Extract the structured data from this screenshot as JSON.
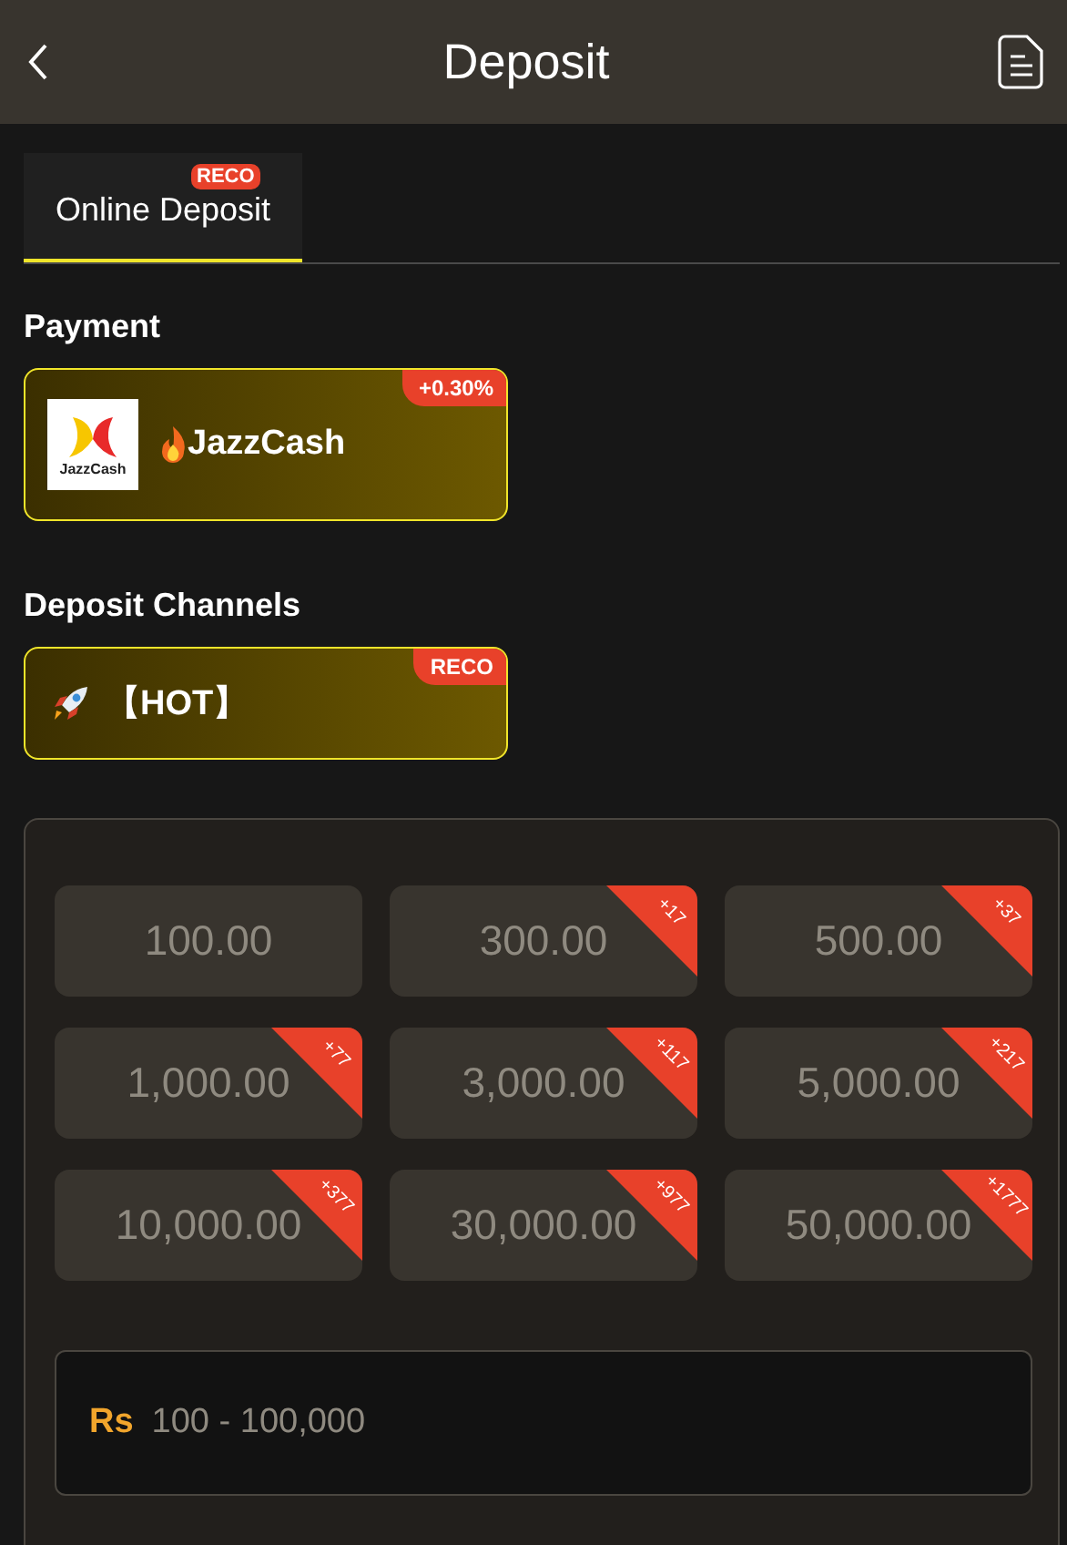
{
  "header": {
    "title": "Deposit"
  },
  "tabs": [
    {
      "label": "Online Deposit",
      "badge": "RECO",
      "selected": true
    }
  ],
  "payment": {
    "heading": "Payment",
    "methods": [
      {
        "logo_text": "JazzCash",
        "name": "JazzCash",
        "badge": "+0.30%"
      }
    ]
  },
  "channels": {
    "heading": "Deposit Channels",
    "items": [
      {
        "name": "【HOT】",
        "badge": "RECO"
      }
    ]
  },
  "amounts": [
    {
      "value": "100.00"
    },
    {
      "value": "300.00",
      "bonus": "+17"
    },
    {
      "value": "500.00",
      "bonus": "+37"
    },
    {
      "value": "1,000.00",
      "bonus": "+77"
    },
    {
      "value": "3,000.00",
      "bonus": "+117"
    },
    {
      "value": "5,000.00",
      "bonus": "+217"
    },
    {
      "value": "10,000.00",
      "bonus": "+377"
    },
    {
      "value": "30,000.00",
      "bonus": "+977"
    },
    {
      "value": "50,000.00",
      "bonus": "+1777"
    }
  ],
  "amount_field": {
    "currency": "Rs",
    "placeholder": "100 - 100,000"
  }
}
